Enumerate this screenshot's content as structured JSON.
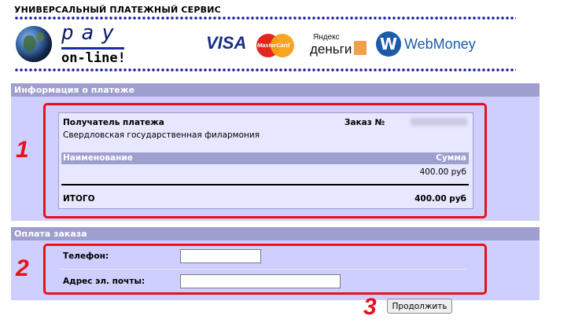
{
  "header": {
    "service_title": "УНИВЕРСАЛЬНЫЙ ПЛАТЕЖНЫЙ СЕРВИС",
    "brand": {
      "pay": "pay",
      "online": "on-line!"
    },
    "payment_logos": {
      "visa": "VISA",
      "mastercard": "MasterCard",
      "yandex_top": "Яндекс",
      "yandex_bottom": "деньги",
      "webmoney": "WebMoney"
    }
  },
  "payment_info": {
    "heading": "Информация о платеже",
    "recipient_label": "Получатель платежа",
    "recipient_name": "Свердловская государственная филармония",
    "order_label": "Заказ №",
    "columns": {
      "item": "Наименование",
      "amount": "Сумма"
    },
    "rows": [
      {
        "amount": "400.00 руб"
      }
    ],
    "total_label": "ИТОГО",
    "total_value": "400.00 руб"
  },
  "order_payment": {
    "heading": "Оплата заказа",
    "phone_label": "Телефон:",
    "phone_value": "",
    "email_label": "Адрес эл. почты:",
    "email_value": "",
    "continue_label": "Продолжить"
  },
  "annotations": {
    "step1": "1",
    "step2": "2",
    "step3": "3",
    "color": "#e8101a"
  },
  "colors": {
    "panel_bg": "#cfcfff",
    "panel_header": "#9f9fcf",
    "card_bg": "#e7e7ff",
    "dots": "#1a1a9e"
  }
}
